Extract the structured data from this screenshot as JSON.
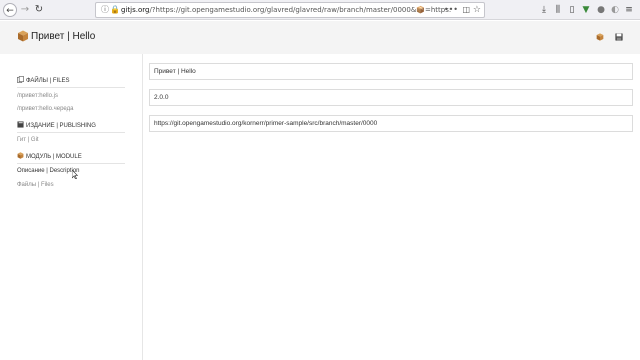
{
  "browser": {
    "url_host": "gitjs.org",
    "url_rest": "/?https://git.opengamestudio.org/glavred/glavred/raw/branch/master/0000&📦=https://git.opengamestudio",
    "icons": [
      "back-icon",
      "forward-icon",
      "reload-icon",
      "info-icon",
      "lock-icon",
      "page-actions-icon",
      "pocket-icon",
      "bookmark-star-icon",
      "downloads-icon",
      "library-icon",
      "sidebar-icon",
      "vpn-icon",
      "extension-icon",
      "ghostery-icon",
      "menu-icon"
    ]
  },
  "header": {
    "title": "Привет | Hello",
    "logo_icon": "package-icon",
    "actions": [
      "package-icon",
      "save-icon"
    ]
  },
  "sidebar": {
    "sections": [
      {
        "id": "files",
        "icon": "documents-icon",
        "label": "ФАЙЛЫ | FILES",
        "items": [
          {
            "label": "/привет:hello.js"
          },
          {
            "label": "/привет:hello.череда"
          }
        ]
      },
      {
        "id": "publishing",
        "icon": "book-icon",
        "label": "ИЗДАНИЕ | PUBLISHING",
        "items": [
          {
            "label": "Гит | Git"
          }
        ]
      },
      {
        "id": "module",
        "icon": "package-icon",
        "label": "МОДУЛЬ | MODULE",
        "items": [
          {
            "label": "Описание | Description",
            "active": true
          },
          {
            "label": "Файлы | Files"
          }
        ]
      }
    ]
  },
  "main": {
    "fields": [
      {
        "name": "module-name",
        "value": "Привет | Hello"
      },
      {
        "name": "module-version",
        "value": "2.0.0"
      },
      {
        "name": "module-source-url",
        "value": "https://git.opengamestudio.org/kornerr/primer-sample/src/branch/master/0000"
      }
    ]
  }
}
